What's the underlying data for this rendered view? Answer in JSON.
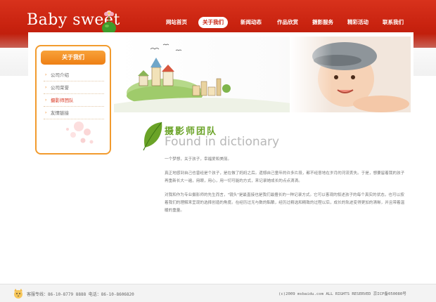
{
  "header": {
    "logo_text": "Baby sweet",
    "nav": [
      {
        "label": "网站首页"
      },
      {
        "label": "关于我们"
      },
      {
        "label": "新闻动态"
      },
      {
        "label": "作品欣赏"
      },
      {
        "label": "摄影服务"
      },
      {
        "label": "精彩活动"
      },
      {
        "label": "联系我们"
      }
    ],
    "active_nav": "关于我们"
  },
  "sidebar": {
    "title": "关于我们",
    "items": [
      {
        "label": "公司介绍"
      },
      {
        "label": "公司荣誉"
      },
      {
        "label": "摄影师团队"
      },
      {
        "label": "友情链接"
      }
    ],
    "active_item": "摄影师团队"
  },
  "section": {
    "title_cn": "摄影师团队",
    "title_en": "Found in dictionary"
  },
  "content": {
    "paragraphs": [
      "一个梦想，关于孩子，幸福爱和美丽。",
      "真正地感到自己也曾经是个孩子，是在做了妈妈之后。遗憾自己童年的许多片段，都不经意地在岁月的河流丢失。于是，想要留着我的孩子再重新长大一遍，用眼，用心，用一切可能的方式，来记录她成长的点点滴滴。",
      "对我和作为专业摄影师的先生而言，\"镜头\"是最直接也是我们最擅长的一种记录方式。它可以客观的叙述孩子的每个真实的状态，也可以按着我们的理解来呈现的选择创造的角度。在经历过无与数的酝酿，经历过精选和精致的过程以后，成长的轨迹变得更加的清晰，并且带着温暖的重量。"
    ]
  },
  "footer": {
    "contact": "客服专线：86-10-8779 8888  电话：86-10-8606820",
    "copyright": "(c)2009 msbaidu.com ALL RIGHTS RESERVED  京ICP备050080号"
  },
  "colors": {
    "brand_red": "#c8220f",
    "accent_orange": "#ee7f14",
    "title_green": "#6aa327"
  }
}
